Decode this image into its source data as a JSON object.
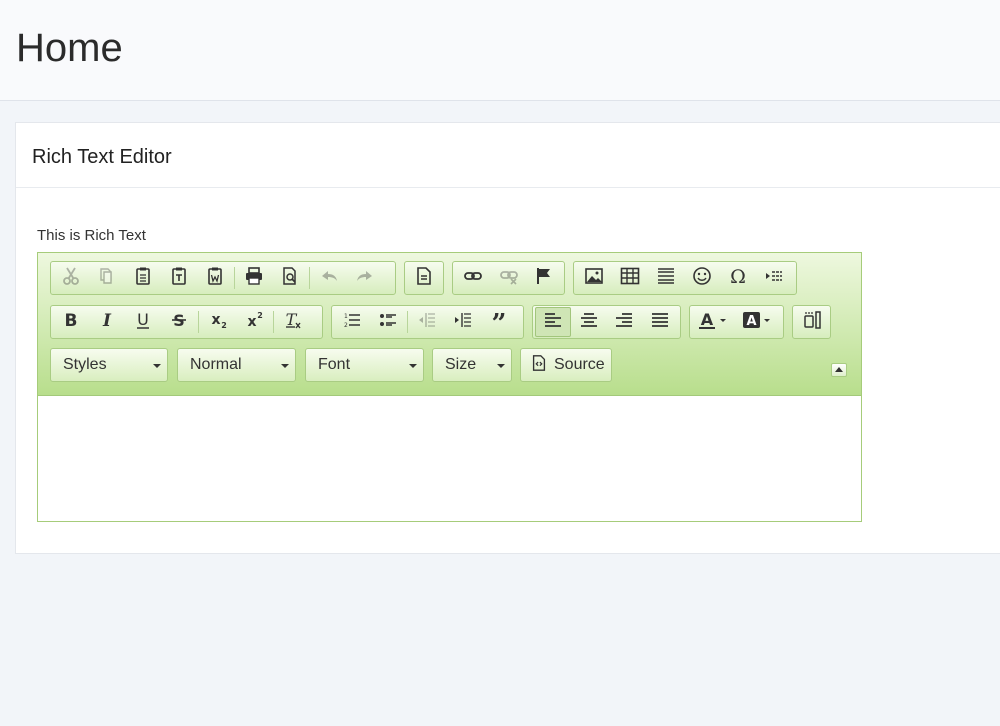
{
  "page": {
    "title": "Home"
  },
  "card": {
    "title": "Rich Text Editor"
  },
  "field": {
    "label": "This is Rich Text"
  },
  "editor": {
    "content": "",
    "combos": {
      "styles": "Styles",
      "format": "Normal",
      "font": "Font",
      "size": "Size"
    },
    "source_label": "Source"
  },
  "colors": {
    "toolbar_gradient_top": "#eef8df",
    "toolbar_gradient_bottom": "#b8de8c",
    "editor_border": "#a6cc7a"
  }
}
